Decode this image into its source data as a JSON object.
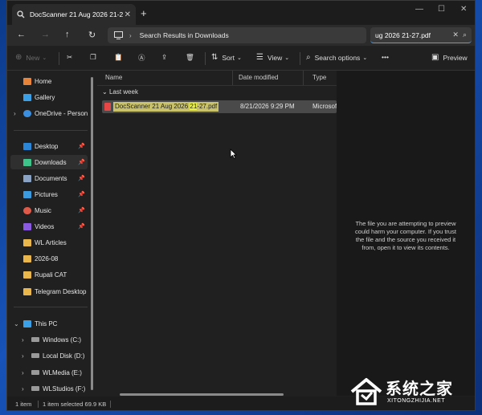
{
  "tab": {
    "title": "DocScanner 21 Aug 2026 21-2",
    "close": "✕",
    "new": "+"
  },
  "window_controls": {
    "minimize": "—",
    "maximize": "☐",
    "close": "✕"
  },
  "nav": {
    "back": "←",
    "forward": "→",
    "up": "↑",
    "refresh": "↻"
  },
  "address": {
    "monitor_icon": "monitor-icon",
    "separator": "›",
    "crumb": "Search Results in Downloads"
  },
  "search": {
    "value": "ug 2026 21-27.pdf",
    "clear": "✕",
    "icon": "⌕"
  },
  "toolbar": {
    "new_label": "New",
    "sort_label": "Sort",
    "view_label": "View",
    "search_options_label": "Search options",
    "more": "•••",
    "preview_label": "Preview"
  },
  "sidebar": {
    "items": [
      {
        "label": "Home",
        "color": "#e8833a"
      },
      {
        "label": "Gallery",
        "color": "#3aa0e8"
      },
      {
        "label": "OneDrive - Person",
        "color": "#3b8fe0"
      },
      {
        "label": "Desktop",
        "color": "#2b86d8"
      },
      {
        "label": "Downloads",
        "color": "#3ec48a"
      },
      {
        "label": "Documents",
        "color": "#8aa3c4"
      },
      {
        "label": "Pictures",
        "color": "#3a9be0"
      },
      {
        "label": "Music",
        "color": "#e05a4a"
      },
      {
        "label": "Videos",
        "color": "#8a5ae0"
      },
      {
        "label": "WL Articles",
        "color": "#e8b64a"
      },
      {
        "label": "2026-08",
        "color": "#e8b64a"
      },
      {
        "label": "Rupali CAT",
        "color": "#e8b64a"
      },
      {
        "label": "Telegram Desktop",
        "color": "#e8b64a"
      },
      {
        "label": "This PC",
        "color": "#3aa0e8"
      },
      {
        "label": "Windows (C:)",
        "color": "#9a9a9a"
      },
      {
        "label": "Local Disk (D:)",
        "color": "#9a9a9a"
      },
      {
        "label": "WLMedia (E:)",
        "color": "#9a9a9a"
      },
      {
        "label": "WLStudios (F:)",
        "color": "#9a9a9a"
      }
    ],
    "pin": "📌",
    "chevron": "›",
    "chevron_open": "⌄"
  },
  "columns": {
    "name": "Name",
    "date": "Date modified",
    "type": "Type"
  },
  "group_label": "Last week",
  "group_chevron": "⌄",
  "file": {
    "name_pre": "DocScanner 21 Aug 2026 ",
    "name_hl": "21",
    "name_post": "-27.pdf",
    "date": "8/21/2026 9:29 PM",
    "type": "Microsoft E"
  },
  "preview_message": "The file you are attempting to preview could harm your computer. If you trust the file and the source you received it from, open it to view its contents.",
  "status": {
    "count": "1 item",
    "selected": "1 item selected  69.9 KB"
  },
  "watermark": {
    "cn": "系统之家",
    "en": "XITONGZHIJIA.NET"
  }
}
